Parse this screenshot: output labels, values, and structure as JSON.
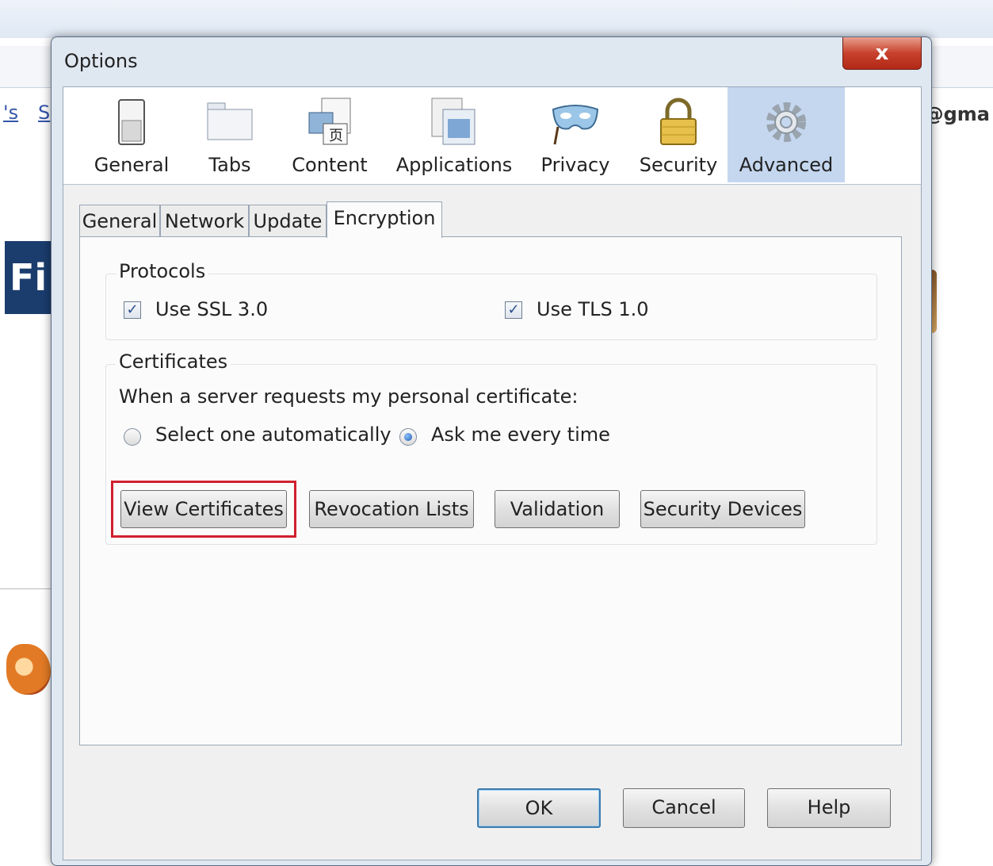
{
  "background": {
    "links_left": "'s",
    "links_right": "S",
    "email_fragment": "@gma",
    "logo_text": "Fi"
  },
  "dialog": {
    "title": "Options",
    "close_label": "x"
  },
  "toolbar": {
    "items": [
      {
        "label": "General",
        "icon": "switch-icon"
      },
      {
        "label": "Tabs",
        "icon": "tabs-icon"
      },
      {
        "label": "Content",
        "icon": "content-icon"
      },
      {
        "label": "Applications",
        "icon": "applications-icon"
      },
      {
        "label": "Privacy",
        "icon": "mask-icon"
      },
      {
        "label": "Security",
        "icon": "padlock-icon"
      },
      {
        "label": "Advanced",
        "icon": "gear-icon"
      }
    ],
    "active": "Advanced"
  },
  "tabs": {
    "items": [
      "General",
      "Network",
      "Update",
      "Encryption"
    ],
    "selected": "Encryption"
  },
  "protocols": {
    "legend": "Protocols",
    "ssl_label": "Use SSL 3.0",
    "ssl_checked": true,
    "tls_label": "Use TLS 1.0",
    "tls_checked": true
  },
  "certificates": {
    "legend": "Certificates",
    "prompt": "When a server requests my personal certificate:",
    "option_auto": "Select one automatically",
    "option_ask": "Ask me every time",
    "selected_option": "Ask me every time",
    "buttons": {
      "view": "View Certificates",
      "revocation": "Revocation Lists",
      "validation": "Validation",
      "devices": "Security Devices"
    }
  },
  "footer": {
    "ok": "OK",
    "cancel": "Cancel",
    "help": "Help"
  },
  "highlight_color": "#d0202e"
}
